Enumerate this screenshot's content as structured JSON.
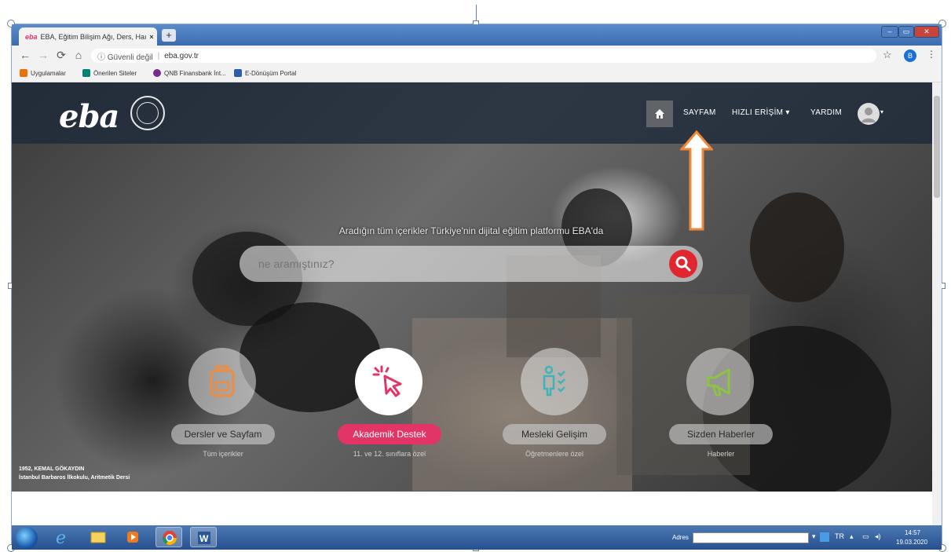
{
  "browser": {
    "tab_title": "EBA, Eğitim Bilişim Ağı, Ders, Haı",
    "tab_close": "×",
    "tab_favicon": "eba",
    "new_tab": "+",
    "security_label": "ⓘ Güvenli değil",
    "url": "eba.gov.tr",
    "profile_initial": "B",
    "bookmarks": [
      {
        "label": "Uygulamalar",
        "icon": "apps-grid-icon",
        "color": "#e8710a"
      },
      {
        "label": "Önerilen Siteler",
        "icon": "bing-icon",
        "color": "#008373"
      },
      {
        "label": "QNB Finansbank İnt...",
        "icon": "qnb-icon",
        "color": "#7a2a8a"
      },
      {
        "label": "E-Dönüşüm Portal",
        "icon": "edonusum-icon",
        "color": "#2b5fa8"
      }
    ]
  },
  "eba": {
    "logo": "eba",
    "nav": {
      "sayfam": "SAYFAM",
      "hizli_erisim": "HIZLI ERİŞİM ▾",
      "yardim": "YARDIM"
    },
    "tagline": "Aradığın tüm içerikler Türkiye'nin dijital eğitim platformu EBA'da",
    "search_placeholder": "ne aramıştınız?",
    "tiles": [
      {
        "label": "Dersler ve Sayfam",
        "sub": "Tüm içerikler",
        "icon": "backpack-icon",
        "color": "#f08c3c"
      },
      {
        "label": "Akademik Destek",
        "sub": "11. ve 12. sınıflara özel",
        "icon": "cursor-click-icon",
        "color": "#e23566"
      },
      {
        "label": "Mesleki Gelişim",
        "sub": "Öğretmenlere özel",
        "icon": "teacher-checklist-icon",
        "color": "#3fb3b8"
      },
      {
        "label": "Sizden Haberler",
        "sub": "Haberler",
        "icon": "megaphone-icon",
        "color": "#8cc63f"
      }
    ],
    "caption_line1": "1952, KEMAL GÖKAYDIN",
    "caption_line2": "İstanbul Barbaros İlkokulu, Aritmetik Dersi"
  },
  "taskbar": {
    "adres_label": "Adres",
    "lang": "TR",
    "time": "14:57",
    "date": "19.03.2020"
  },
  "colors": {
    "accent_red": "#e0262f",
    "accent_pink": "#e23566",
    "annotation_arrow": "#f0883a"
  }
}
